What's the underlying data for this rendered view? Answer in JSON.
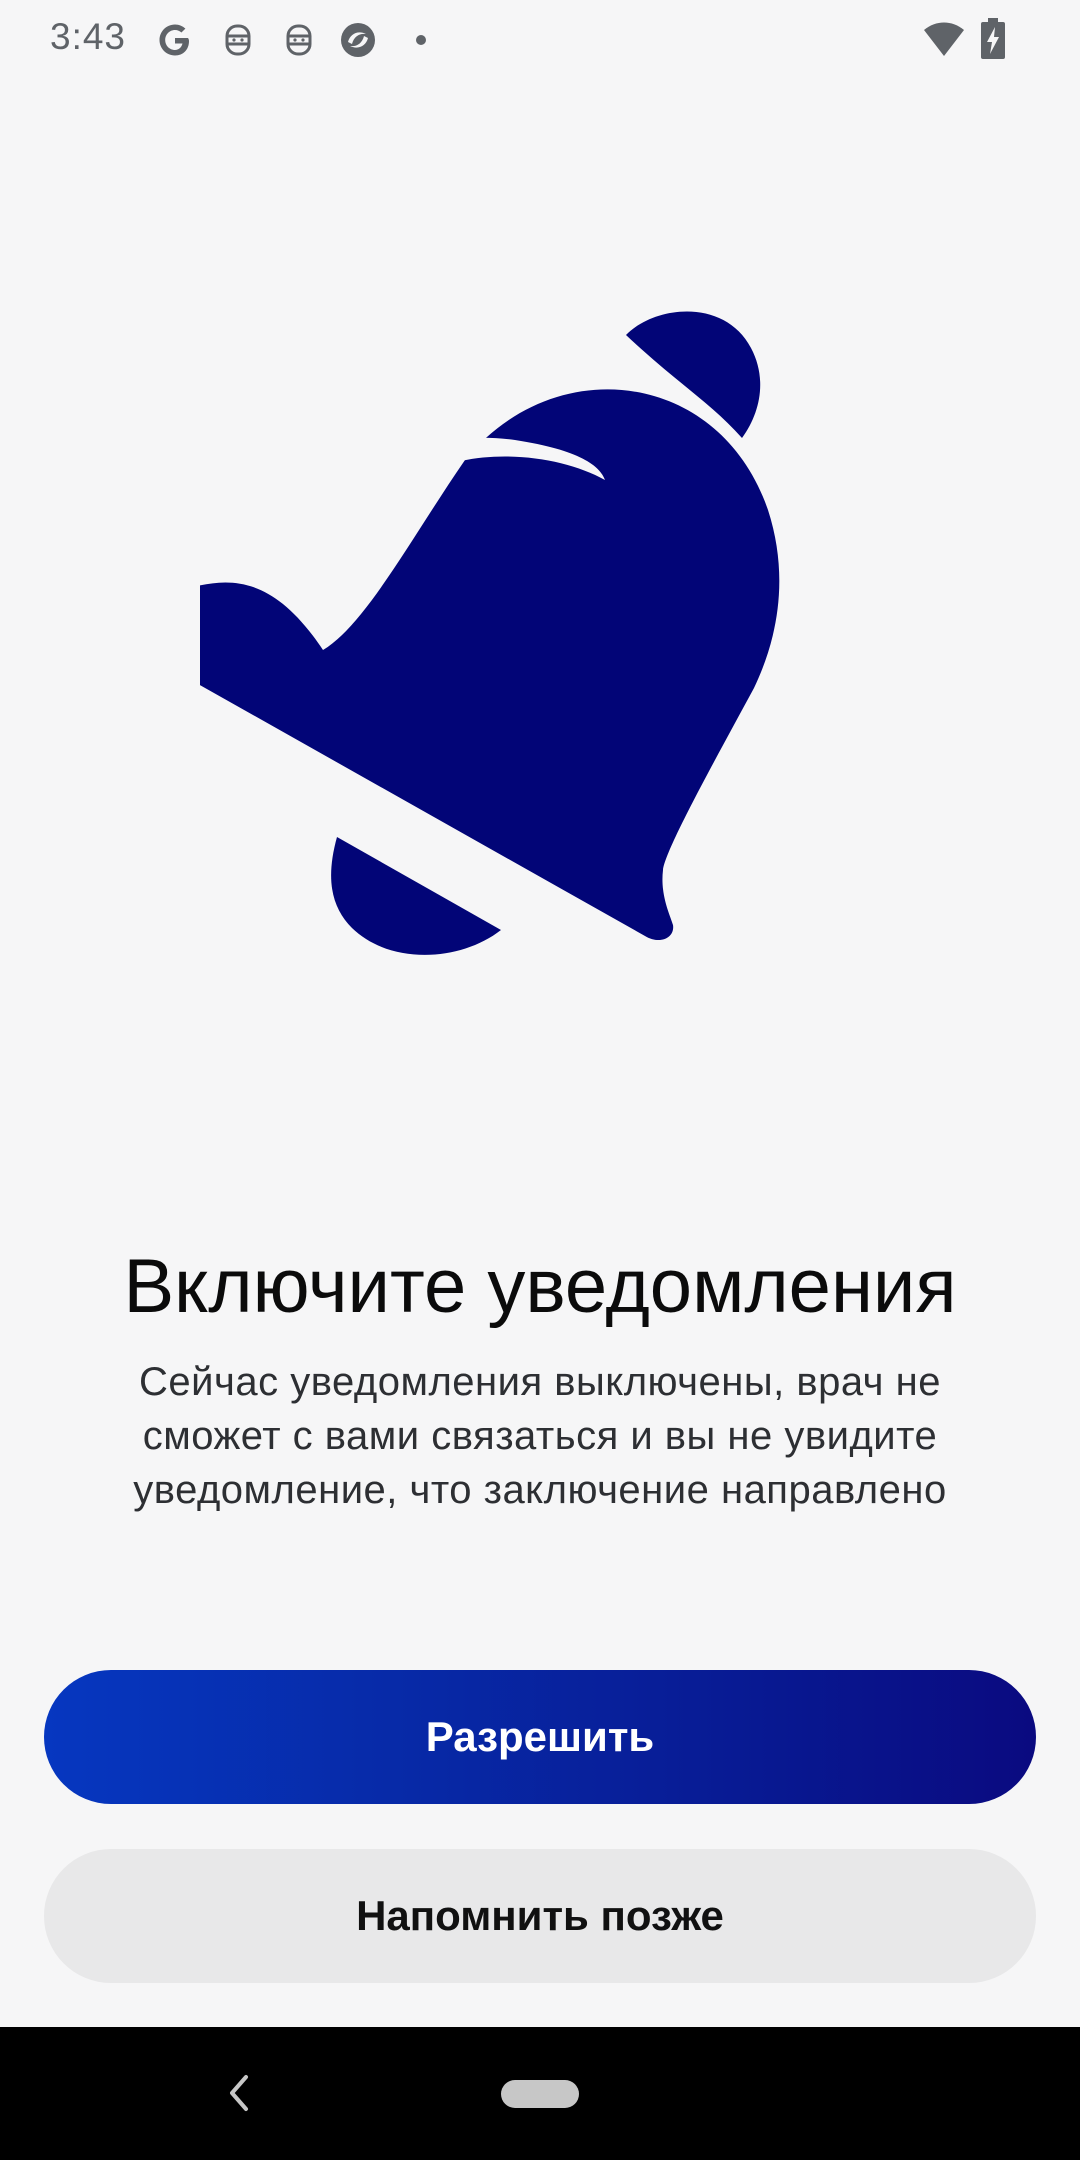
{
  "status_bar": {
    "time": "3:43",
    "icons": [
      "google-icon",
      "mascot-notification-icon",
      "mascot-notification-icon",
      "app-notification-icon",
      "more-notifications-dot-icon",
      "wifi-icon",
      "battery-charging-icon"
    ]
  },
  "hero": {
    "icon": "bell-icon",
    "color": "#020577"
  },
  "content": {
    "title": "Включите уведомления",
    "description_lines": [
      "Сейчас уведомления выключены, врач не",
      "сможет с вами связаться и вы не увидите",
      "уведомление, что заключение направлено"
    ]
  },
  "actions": {
    "allow_label": "Разрешить",
    "later_label": "Напомнить позже"
  },
  "colors": {
    "background": "#f6f6f7",
    "primary_gradient_start": "#0637c0",
    "primary_gradient_end": "#0a0a80",
    "secondary_button": "#e8e8e9"
  },
  "nav_bar": {
    "icons": [
      "back-icon",
      "home-pill-icon"
    ]
  }
}
